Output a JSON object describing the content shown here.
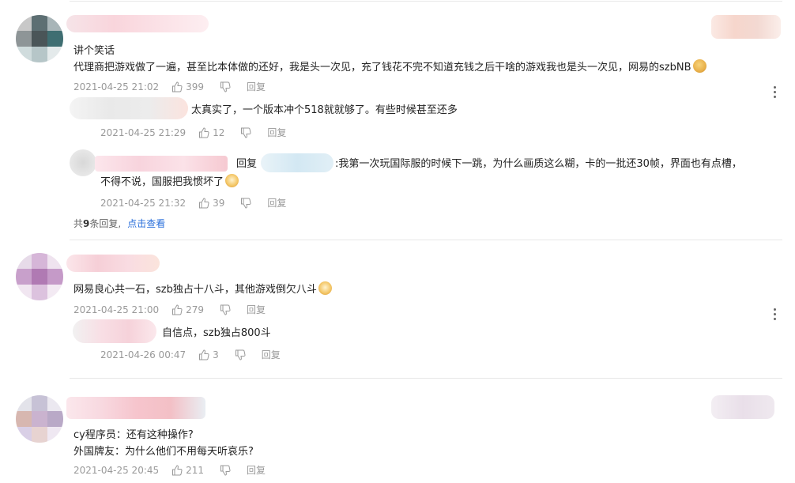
{
  "comments": [
    {
      "body_lines": [
        "讲个笑话",
        "代理商把游戏做了一遍，甚至比本体做的还好，我是头一次见，充了钱花不完不知道充钱之后干啥的游戏我也是头一次见，网易的szbNB"
      ],
      "time": "2021-04-25 21:02",
      "likes": "399",
      "reply_label": "回复",
      "replies": [
        {
          "text": "太真实了，一个版本冲个518就就够了。有些时候甚至还多",
          "time": "2021-04-25 21:29",
          "likes": "12",
          "reply_label": "回复"
        },
        {
          "reply_to_label": "回复",
          "text_lines": [
            ":我第一次玩国际服的时候下一跳，为什么画质这么糊，卡的一批还30帧，界面也有点槽，",
            "不得不说，国服把我惯坏了"
          ],
          "time": "2021-04-25 21:32",
          "likes": "39",
          "reply_label": "回复"
        }
      ],
      "reply_summary": {
        "prefix": "共",
        "count": "9",
        "suffix": "条回复,",
        "link": "点击查看"
      }
    },
    {
      "body_lines": [
        "网易良心共一石，szb独占十八斗，其他游戏倒欠八斗"
      ],
      "time": "2021-04-25 21:00",
      "likes": "279",
      "reply_label": "回复",
      "replies": [
        {
          "text": "自信点，szb独占800斗",
          "time": "2021-04-26 00:47",
          "likes": "3",
          "reply_label": "回复"
        }
      ]
    },
    {
      "body_lines": [
        "cy程序员：还有这种操作?",
        "外国牌友：为什么他们不用每天听哀乐?"
      ],
      "time": "2021-04-25 20:45",
      "likes": "211",
      "reply_label": "回复"
    }
  ],
  "icons": {
    "like": "thumbs-up-icon",
    "dislike": "thumbs-down-icon",
    "more": "more-vertical-icon",
    "emoji": "emoji-icon"
  },
  "colors": {
    "link": "#2a6fdb",
    "meta": "#999999",
    "divider": "#e8e8e8"
  }
}
